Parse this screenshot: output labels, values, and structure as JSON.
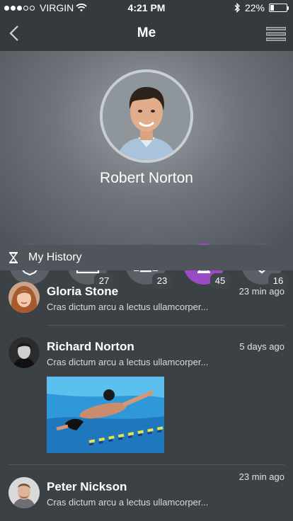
{
  "status": {
    "carrier": "VIRGIN",
    "time": "4:21 PM",
    "battery": "22%",
    "battery_level": 0.22
  },
  "nav": {
    "title": "Me"
  },
  "profile": {
    "name": "Robert Norton"
  },
  "stats": [
    {
      "icon": "badge-icon",
      "count": ""
    },
    {
      "icon": "image-icon",
      "count": "27"
    },
    {
      "icon": "group-icon",
      "count": "23"
    },
    {
      "icon": "hourglass-icon",
      "count": "45",
      "active": true
    },
    {
      "icon": "heart-icon",
      "count": "16"
    }
  ],
  "history": {
    "title": "My History",
    "items": [
      {
        "name": "Gloria Stone",
        "time": "23 min ago",
        "message": "Cras dictum arcu a lectus ullamcorper..."
      },
      {
        "name": "Richard Norton",
        "time": "5 days ago",
        "message": "Cras dictum arcu a lectus ullamcorper..."
      },
      {
        "name": "Peter Nickson",
        "time": "23 min ago",
        "message": "Cras dictum arcu a lectus ullamcorper..."
      }
    ]
  },
  "colors": {
    "accent": "#9b4bc4",
    "background": "#3c4146",
    "section": "#4f555a"
  }
}
